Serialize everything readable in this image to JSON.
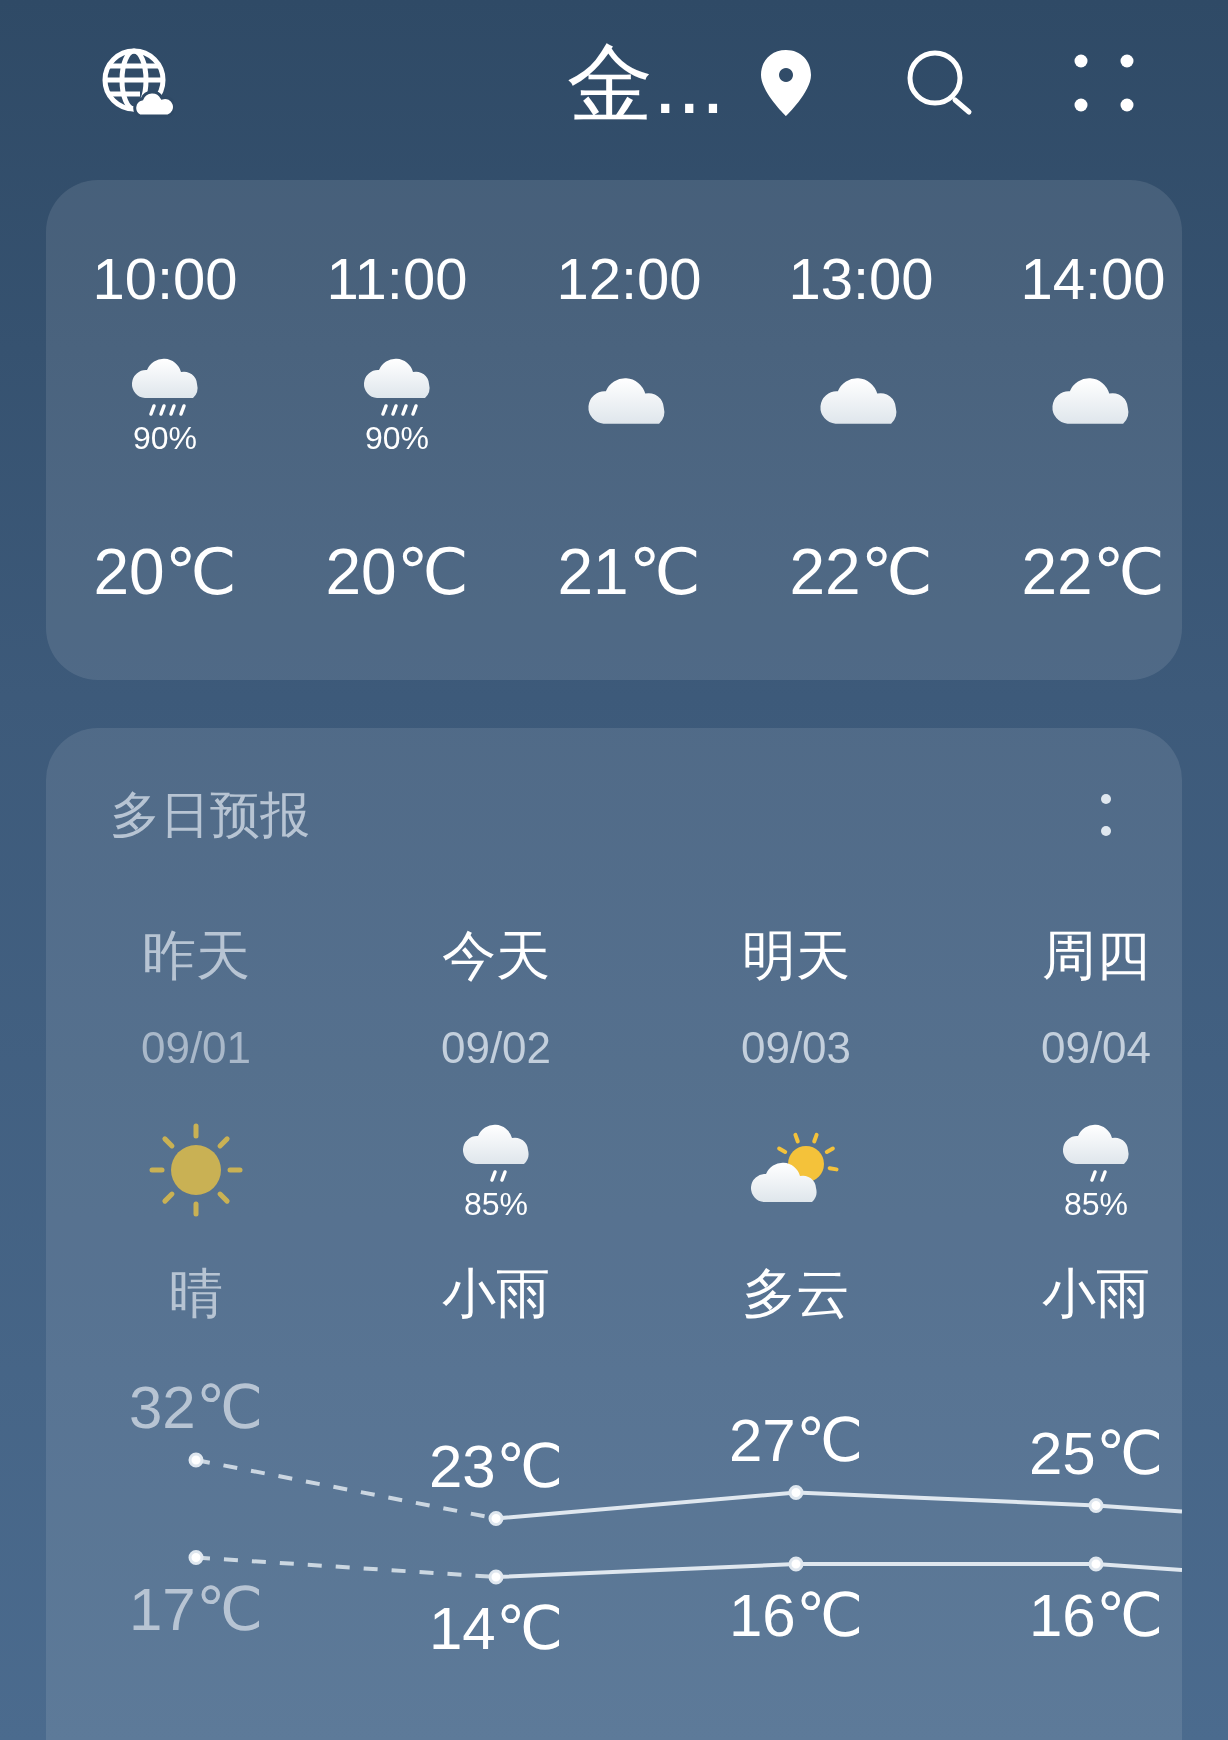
{
  "header": {
    "title": "金..."
  },
  "hourly": [
    {
      "time": "10:00",
      "kind": "rain",
      "precip": "90%",
      "temp": "20℃"
    },
    {
      "time": "11:00",
      "kind": "rain",
      "precip": "90%",
      "temp": "20℃"
    },
    {
      "time": "12:00",
      "kind": "cloudy",
      "temp": "21℃"
    },
    {
      "time": "13:00",
      "kind": "cloudy",
      "temp": "22℃"
    },
    {
      "time": "14:00",
      "kind": "cloudy",
      "temp": "22℃"
    }
  ],
  "forecast": {
    "title": "多日预报",
    "days": [
      {
        "day": "昨天",
        "kind": "sunny",
        "condition": "晴",
        "past": true
      },
      {
        "day": "今天",
        "kind": "light-rain",
        "precip": "85%",
        "condition": "小雨",
        "past": false
      },
      {
        "day": "明天",
        "kind": "partly-cloudy",
        "condition": "多云",
        "past": false
      },
      {
        "day": "周四",
        "kind": "light-rain",
        "precip": "85%",
        "condition": "小雨",
        "past": false
      }
    ],
    "chart_data": {
      "type": "line",
      "categories": [
        "09/01",
        "09/02",
        "09/03",
        "09/04"
      ],
      "series": [
        {
          "color": "#dfe7ef",
          "marker": true,
          "values": [
            32,
            23,
            27,
            25
          ],
          "value_labels": [
            "32℃",
            "23℃",
            "27℃",
            "25℃"
          ]
        },
        {
          "color": "#dfe7ef",
          "marker": true,
          "values": [
            17,
            14,
            16,
            16
          ],
          "value_labels": [
            "17℃",
            "14℃",
            "16℃",
            "16℃"
          ]
        }
      ]
    }
  }
}
